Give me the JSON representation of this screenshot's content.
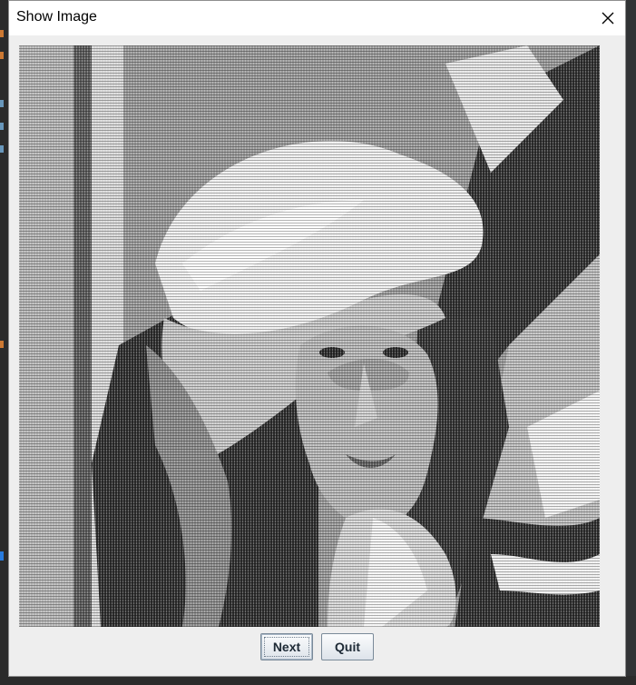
{
  "window": {
    "title": "Show Image",
    "close_icon": "close-icon"
  },
  "image": {
    "description_icon": "dithered-portrait-image"
  },
  "buttons": {
    "next_label": "Next",
    "quit_label": "Quit"
  },
  "colors": {
    "titlebar": "#ffffff",
    "content": "#eeeeee",
    "button_text": "#1e2a36"
  }
}
